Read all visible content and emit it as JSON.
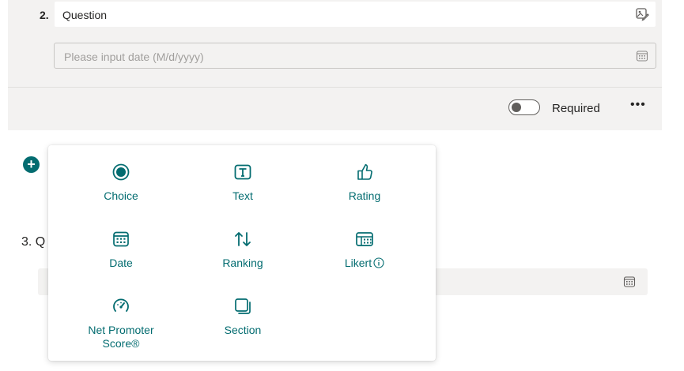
{
  "question2": {
    "number": "2.",
    "title": "Question",
    "date_placeholder": "Please input date (M/d/yyyy)",
    "required_label": "Required",
    "more_label": "•••"
  },
  "add_button": {
    "label": "+"
  },
  "question3": {
    "label": "3. Q"
  },
  "insert_menu": {
    "items": [
      {
        "label": "Choice",
        "icon": "radio-icon"
      },
      {
        "label": "Text",
        "icon": "text-icon"
      },
      {
        "label": "Rating",
        "icon": "thumbs-up-icon"
      },
      {
        "label": "Date",
        "icon": "calendar-icon"
      },
      {
        "label": "Ranking",
        "icon": "ranking-icon"
      },
      {
        "label": "Likert",
        "icon": "likert-icon"
      },
      {
        "label": "Net Promoter Score®",
        "icon": "gauge-icon"
      },
      {
        "label": "Section",
        "icon": "section-icon"
      }
    ]
  },
  "colors": {
    "accent": "#036c70",
    "card_bg": "#f3f2f1"
  }
}
